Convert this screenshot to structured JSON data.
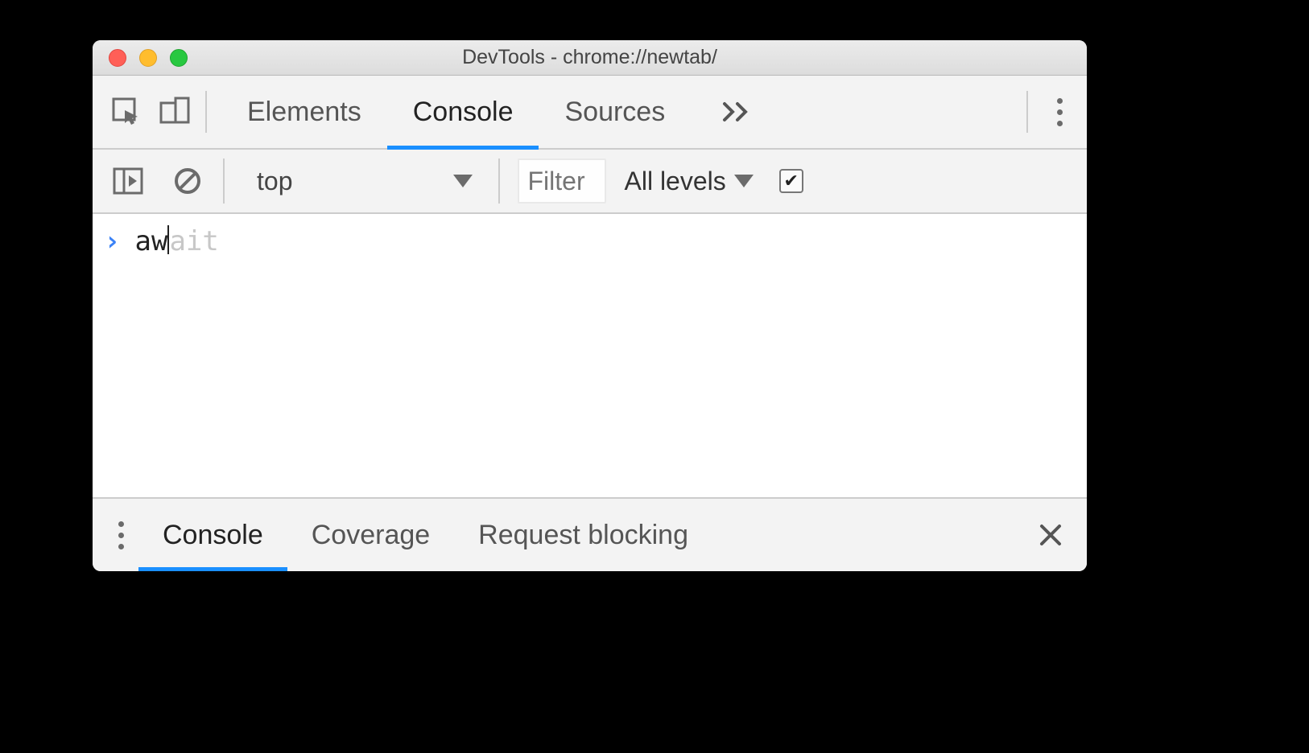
{
  "window": {
    "title": "DevTools - chrome://newtab/"
  },
  "tabbar": {
    "tabs": [
      "Elements",
      "Console",
      "Sources"
    ],
    "active_index": 1
  },
  "subbar": {
    "context": "top",
    "filter_placeholder": "Filter",
    "levels_label": "All levels",
    "checkbox_checked": true
  },
  "console": {
    "typed": "aw",
    "suggestion_tail": "ait"
  },
  "drawer": {
    "tabs": [
      "Console",
      "Coverage",
      "Request blocking"
    ],
    "active_index": 0
  }
}
